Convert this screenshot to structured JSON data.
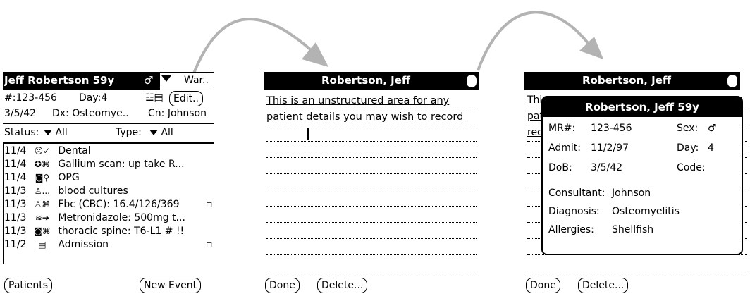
{
  "screen1": {
    "title_name": "Jeff Robertson 59y",
    "title_sex": "♂",
    "ward_label": "War..",
    "row1": {
      "mrn": "#:123-456",
      "day": "Day:4",
      "edit": "Edit.."
    },
    "row2": {
      "dob": "3/5/42",
      "dx": "Dx: Osteomye..",
      "cn": "Cn: Johnson"
    },
    "filters": {
      "status_label": "Status:",
      "status_value": "All",
      "type_label": "Type:",
      "type_value": "All"
    },
    "events": [
      {
        "date": "11/4",
        "icon": "☹✓",
        "text": "Dental"
      },
      {
        "date": "11/4",
        "icon": "✪⌘",
        "text": "Gallium scan: up take R..."
      },
      {
        "date": "11/4",
        "icon": "◙♀",
        "text": "OPG"
      },
      {
        "date": "11/3",
        "icon": "♙...",
        "text": "blood cultures"
      },
      {
        "date": "11/3",
        "icon": "♙⌘",
        "text": "Fbc (CBC): 16.4/126/369"
      },
      {
        "date": "11/3",
        "icon": "≋➔",
        "text": "Metronidazole: 500mg t..."
      },
      {
        "date": "11/3",
        "icon": "◙⌘",
        "text": "thoracic spine: T6-L1 # !!"
      },
      {
        "date": "11/2",
        "icon": "▤",
        "text": "Admission"
      }
    ],
    "buttons": {
      "patients": "Patients",
      "new_event": "New Event"
    }
  },
  "screen2": {
    "title": "Robertson, Jeff",
    "note": "This is an unstructured area for any patient details you may wish to record",
    "buttons": {
      "done": "Done",
      "delete": "Delete..."
    }
  },
  "screen3": {
    "title": "Robertson, Jeff",
    "background_text": [
      "Thi",
      "pat",
      "rec"
    ],
    "popup": {
      "title": "Robertson, Jeff 59y",
      "mr_label": "MR#:",
      "mr_value": "123-456",
      "sex_label": "Sex:",
      "sex_value": "♂",
      "admit_label": "Admit:",
      "admit_value": "11/2/97",
      "day_label": "Day:",
      "day_value": "4",
      "dob_label": "DoB:",
      "dob_value": "3/5/42",
      "code_label": "Code:",
      "consultant_label": "Consultant:",
      "consultant_value": "Johnson",
      "diagnosis_label": "Diagnosis:",
      "diagnosis_value": "Osteomyelitis",
      "allergies_label": "Allergies:",
      "allergies_value": "Shellfish"
    },
    "buttons": {
      "done": "Done",
      "delete": "Delete..."
    }
  },
  "colors": {
    "arrow": "#b3b3b3",
    "titlebar": "#000000",
    "background": "#ffffff"
  }
}
